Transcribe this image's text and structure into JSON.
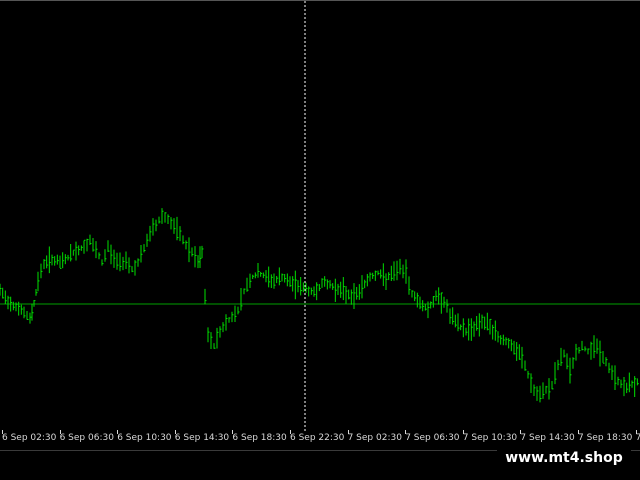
{
  "window": {
    "background": "#000000",
    "candle_color": "#00e000",
    "level_line_color": "#00a000",
    "crosshair_color": "#ffffff",
    "axis_text_color": "#d8d8d8"
  },
  "watermark": {
    "text": "www.mt4.shop"
  },
  "chart_data": {
    "type": "line",
    "series": [
      {
        "points": [
          {
            "x": 0,
            "y": 290
          },
          {
            "x": 8,
            "y": 300
          },
          {
            "x": 16,
            "y": 305
          },
          {
            "x": 24,
            "y": 312
          },
          {
            "x": 30,
            "y": 318
          },
          {
            "x": 34,
            "y": 302
          },
          {
            "x": 38,
            "y": 280
          },
          {
            "x": 44,
            "y": 262
          },
          {
            "x": 52,
            "y": 258
          },
          {
            "x": 60,
            "y": 262
          },
          {
            "x": 68,
            "y": 256
          },
          {
            "x": 76,
            "y": 250
          },
          {
            "x": 84,
            "y": 246
          },
          {
            "x": 90,
            "y": 240
          },
          {
            "x": 96,
            "y": 250
          },
          {
            "x": 102,
            "y": 262
          },
          {
            "x": 108,
            "y": 246
          },
          {
            "x": 114,
            "y": 258
          },
          {
            "x": 120,
            "y": 262
          },
          {
            "x": 126,
            "y": 258
          },
          {
            "x": 132,
            "y": 268
          },
          {
            "x": 138,
            "y": 262
          },
          {
            "x": 144,
            "y": 248
          },
          {
            "x": 150,
            "y": 232
          },
          {
            "x": 156,
            "y": 224
          },
          {
            "x": 162,
            "y": 214
          },
          {
            "x": 168,
            "y": 218
          },
          {
            "x": 174,
            "y": 226
          },
          {
            "x": 180,
            "y": 234
          },
          {
            "x": 186,
            "y": 244
          },
          {
            "x": 192,
            "y": 252
          },
          {
            "x": 198,
            "y": 262
          },
          {
            "x": 202,
            "y": 252
          },
          {
            "x": 205,
            "y": 296
          },
          {
            "x": 208,
            "y": 335
          },
          {
            "x": 214,
            "y": 345
          },
          {
            "x": 220,
            "y": 330
          },
          {
            "x": 226,
            "y": 322
          },
          {
            "x": 232,
            "y": 316
          },
          {
            "x": 238,
            "y": 308
          },
          {
            "x": 244,
            "y": 290
          },
          {
            "x": 250,
            "y": 278
          },
          {
            "x": 258,
            "y": 272
          },
          {
            "x": 266,
            "y": 276
          },
          {
            "x": 274,
            "y": 280
          },
          {
            "x": 282,
            "y": 276
          },
          {
            "x": 290,
            "y": 282
          },
          {
            "x": 298,
            "y": 284
          },
          {
            "x": 306,
            "y": 288
          },
          {
            "x": 314,
            "y": 292
          },
          {
            "x": 322,
            "y": 282
          },
          {
            "x": 330,
            "y": 284
          },
          {
            "x": 338,
            "y": 288
          },
          {
            "x": 346,
            "y": 292
          },
          {
            "x": 354,
            "y": 296
          },
          {
            "x": 362,
            "y": 286
          },
          {
            "x": 370,
            "y": 276
          },
          {
            "x": 378,
            "y": 272
          },
          {
            "x": 386,
            "y": 278
          },
          {
            "x": 394,
            "y": 272
          },
          {
            "x": 400,
            "y": 266
          },
          {
            "x": 406,
            "y": 274
          },
          {
            "x": 412,
            "y": 292
          },
          {
            "x": 420,
            "y": 302
          },
          {
            "x": 428,
            "y": 308
          },
          {
            "x": 436,
            "y": 296
          },
          {
            "x": 444,
            "y": 300
          },
          {
            "x": 450,
            "y": 314
          },
          {
            "x": 458,
            "y": 324
          },
          {
            "x": 466,
            "y": 330
          },
          {
            "x": 474,
            "y": 326
          },
          {
            "x": 482,
            "y": 320
          },
          {
            "x": 490,
            "y": 326
          },
          {
            "x": 498,
            "y": 336
          },
          {
            "x": 506,
            "y": 340
          },
          {
            "x": 514,
            "y": 348
          },
          {
            "x": 522,
            "y": 356
          },
          {
            "x": 528,
            "y": 374
          },
          {
            "x": 534,
            "y": 390
          },
          {
            "x": 540,
            "y": 396
          },
          {
            "x": 546,
            "y": 388
          },
          {
            "x": 552,
            "y": 384
          },
          {
            "x": 558,
            "y": 364
          },
          {
            "x": 564,
            "y": 352
          },
          {
            "x": 570,
            "y": 370
          },
          {
            "x": 576,
            "y": 352
          },
          {
            "x": 582,
            "y": 346
          },
          {
            "x": 588,
            "y": 350
          },
          {
            "x": 594,
            "y": 344
          },
          {
            "x": 600,
            "y": 350
          },
          {
            "x": 606,
            "y": 362
          },
          {
            "x": 612,
            "y": 372
          },
          {
            "x": 618,
            "y": 380
          },
          {
            "x": 624,
            "y": 386
          },
          {
            "x": 632,
            "y": 384
          },
          {
            "x": 640,
            "y": 380
          }
        ]
      }
    ],
    "ylim": [
      0,
      430
    ],
    "xlim": [
      0,
      640
    ],
    "level_line_y": 303,
    "crosshair_x": 305,
    "grid": false,
    "x_tick_labels": [
      "6 Sep 02:30",
      "6 Sep 06:30",
      "6 Sep 10:30",
      "6 Sep 14:30",
      "6 Sep 18:30",
      "6 Sep 22:30",
      "7 Sep 02:30",
      "7 Sep 06:30",
      "7 Sep 10:30",
      "7 Sep 14:30",
      "7 Sep 18:30",
      "7 S"
    ]
  }
}
